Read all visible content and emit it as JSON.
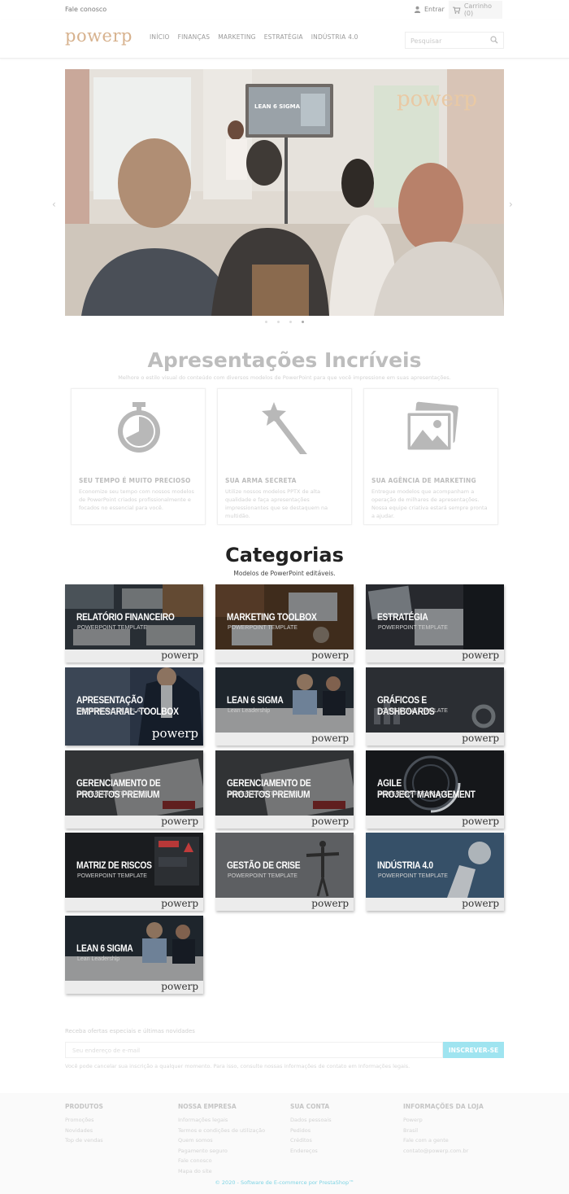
{
  "topbar": {
    "contact": "Fale conosco",
    "signin": "Entrar",
    "cart": "Carrinho (0)"
  },
  "header": {
    "logo": "powerp",
    "nav": [
      "INÍCIO",
      "FINANÇAS",
      "MARKETING",
      "ESTRATÉGIA",
      "INDÚSTRIA 4.0"
    ],
    "search_placeholder": "Pesquisar"
  },
  "hero": {
    "screen_text": "LEAN 6 SIGMA",
    "watermark": "powerp",
    "slides": 4,
    "active_slide": 4
  },
  "features": {
    "title": "Apresentações Incríveis",
    "subtitle": "Melhore o estilo visual do conteúdo com diversos modelos de PowerPoint para que você impressione em suas apresentações.",
    "cards": [
      {
        "icon": "stopwatch-icon",
        "title": "SEU TEMPO É MUITO PRECIOSO",
        "text": "Economize seu tempo com nossos modelos de PowerPoint criados profissionalmente e focados no essencial para você."
      },
      {
        "icon": "magic-wand-icon",
        "title": "SUA ARMA SECRETA",
        "text": "Utilize nossos modelos PPTX de alta qualidade e faça apresentações impressionantes que se destaquem na multidão."
      },
      {
        "icon": "image-gallery-icon",
        "title": "SUA AGÊNCIA DE MARKETING",
        "text": "Entregue modelos que acompanham a operação de milhares de apresentações. Nossa equipe criativa estará sempre pronta a ajudar."
      }
    ]
  },
  "categories": {
    "title": "Categorias",
    "subtitle": "Modelos de PowerPoint editáveis.",
    "items": [
      {
        "title": "RELATÓRIO FINANCEIRO",
        "sub": "POWERPOINT TEMPLATE"
      },
      {
        "title": "MARKETING TOOLBOX",
        "sub": "POWERPOINT TEMPLATE"
      },
      {
        "title": "ESTRATÉGIA",
        "sub": "POWERPOINT TEMPLATE"
      },
      {
        "title": "APRESENTAÇÃO\nEMPRESARIAL- TOOLBOX",
        "sub": "POWERPOINT TEMPLATE"
      },
      {
        "title": "LEAN 6 SIGMA",
        "sub": "Lean Leadership"
      },
      {
        "title": "GRÁFICOS E DASHBOARDS",
        "sub": "POWERPOINT TEMPLATE"
      },
      {
        "title": "GERENCIAMENTO DE\nPROJETOS PREMIUM",
        "sub": "POWERPOINT TEMPLATE"
      },
      {
        "title": "GERENCIAMENTO DE\nPROJETOS PREMIUM",
        "sub": "POWERPOINT TEMPLATE"
      },
      {
        "title": "AGILE\nPROJECT MANAGEMENT",
        "sub": "POWERPOINT TEMPLATE"
      },
      {
        "title": "MATRIZ DE RISCOS",
        "sub": "POWERPOINT TEMPLATE"
      },
      {
        "title": "GESTÃO DE CRISE",
        "sub": "POWERPOINT TEMPLATE"
      },
      {
        "title": "INDÚSTRIA 4.0",
        "sub": "POWERPOINT TEMPLATE"
      },
      {
        "title": "LEAN 6 SIGMA",
        "sub": "Lean Leadership"
      }
    ],
    "logo": "powerp"
  },
  "newsletter": {
    "label": "Receba ofertas especiais e últimas novidades",
    "placeholder": "Seu endereço de e-mail",
    "button": "INSCREVER-SE",
    "note": "Você pode cancelar sua inscrição a qualquer momento. Para isso, consulte nossas informações de contato em Informações legais."
  },
  "footer": {
    "columns": [
      {
        "title": "PRODUTOS",
        "links": [
          "Promoções",
          "Novidades",
          "Top de vendas"
        ]
      },
      {
        "title": "NOSSA EMPRESA",
        "links": [
          "Informações legais",
          "Termos e condições de utilização",
          "Quem somos",
          "Pagamento seguro",
          "Fale conosco",
          "Mapa do site"
        ]
      },
      {
        "title": "SUA CONTA",
        "links": [
          "Dados pessoais",
          "Pedidos",
          "Créditos",
          "Endereços"
        ]
      },
      {
        "title": "INFORMAÇÕES DA LOJA",
        "links": [
          "Powerp",
          "Brasil",
          "Fale com a gente",
          "contato@powerp.com.br"
        ]
      }
    ],
    "copyright": "© 2020 - Software de E-commerce por PrestaShop™"
  }
}
